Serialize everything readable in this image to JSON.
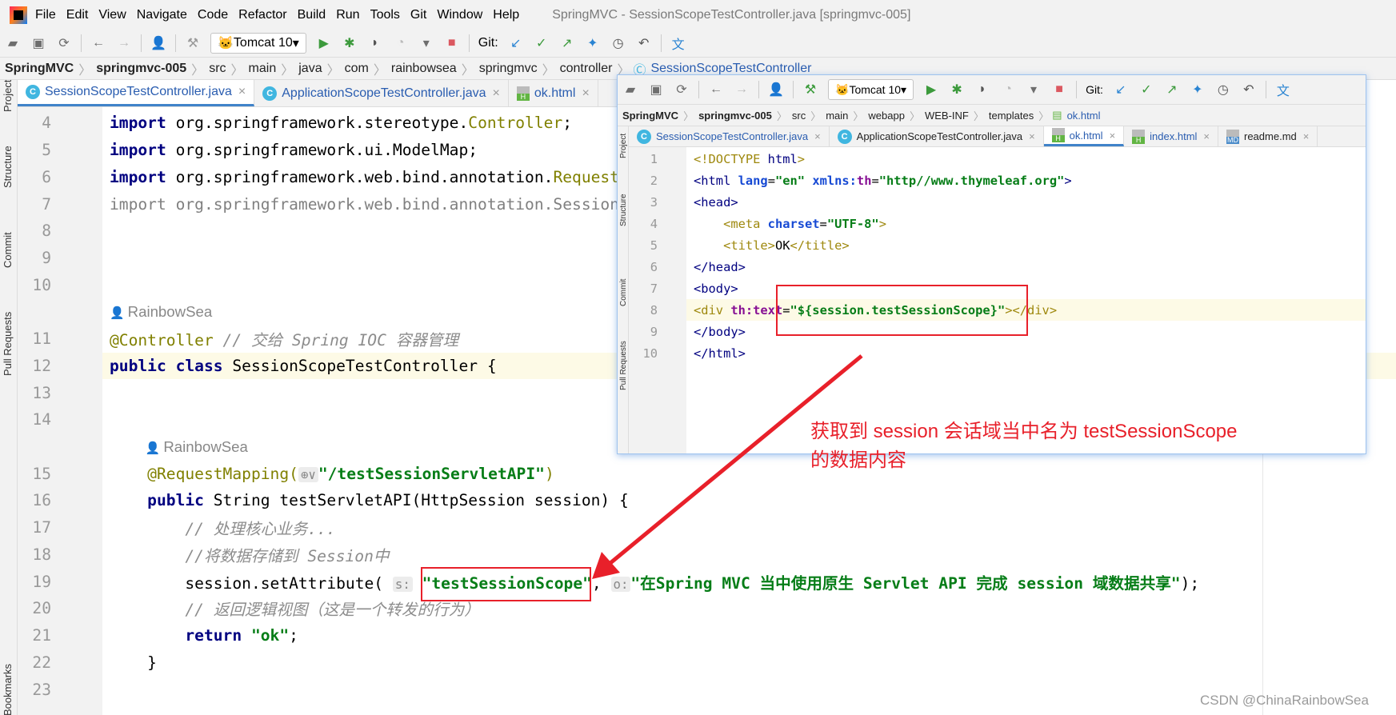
{
  "menubar": {
    "items": [
      "File",
      "Edit",
      "View",
      "Navigate",
      "Code",
      "Refactor",
      "Build",
      "Run",
      "Tools",
      "Git",
      "Window",
      "Help"
    ],
    "title": "SpringMVC - SessionScopeTestController.java [springmvc-005]"
  },
  "toolbar": {
    "run_config": "Tomcat 10",
    "git_label": "Git:"
  },
  "breadcrumb": {
    "items": [
      "SpringMVC",
      "springmvc-005",
      "src",
      "main",
      "java",
      "com",
      "rainbowsea",
      "springmvc",
      "controller",
      "SessionScopeTestController"
    ]
  },
  "tabs": [
    {
      "label": "SessionScopeTestController.java",
      "type": "java",
      "active": true
    },
    {
      "label": "ApplicationScopeTestController.java",
      "type": "java"
    },
    {
      "label": "ok.html",
      "type": "html"
    }
  ],
  "tool_windows": [
    "Project",
    "Structure",
    "Commit",
    "Pull Requests",
    "Bookmarks"
  ],
  "editor": {
    "rows": [
      {
        "ln": "4",
        "seg": [
          [
            "import",
            "kw"
          ],
          [
            " org.springframework.stereotype.",
            "pl"
          ],
          [
            "Controller",
            "ann"
          ],
          [
            ";",
            "pl"
          ]
        ]
      },
      {
        "ln": "5",
        "seg": [
          [
            "import",
            "kw"
          ],
          [
            " org.springframework.ui.ModelMap;",
            "pl"
          ]
        ]
      },
      {
        "ln": "6",
        "seg": [
          [
            "import",
            "kw"
          ],
          [
            " org.springframework.web.bind.annotation.",
            "pl"
          ],
          [
            "RequestMapping",
            "ann"
          ],
          [
            ";",
            "pl"
          ]
        ]
      },
      {
        "ln": "7",
        "seg": [
          [
            "import org.springframework.web.bind.annotation.SessionAttributes;",
            "gray"
          ]
        ]
      },
      {
        "ln": "8",
        "seg": []
      },
      {
        "ln": "9",
        "seg": []
      },
      {
        "ln": "10",
        "seg": []
      },
      {
        "ln": "",
        "inlay": "RainbowSea",
        "indent": 0
      },
      {
        "ln": "11",
        "seg": [
          [
            "@Controller",
            "ann"
          ],
          [
            " // 交给 Spring IOC 容器管理",
            "cm"
          ]
        ]
      },
      {
        "ln": "12",
        "current": true,
        "seg": [
          [
            "public class ",
            "kw"
          ],
          [
            "SessionScopeTestController",
            "pl"
          ],
          [
            " {",
            "pl"
          ]
        ]
      },
      {
        "ln": "13",
        "seg": []
      },
      {
        "ln": "14",
        "seg": []
      },
      {
        "ln": "",
        "inlay": "RainbowSea",
        "indent": 4
      },
      {
        "ln": "15",
        "seg": [
          [
            "    @RequestMapping(",
            "ann"
          ],
          [
            "⊕∨",
            "hint"
          ],
          [
            "\"/testSessionServletAPI\"",
            "str"
          ],
          [
            ")",
            "ann"
          ]
        ]
      },
      {
        "ln": "16",
        "seg": [
          [
            "    public ",
            "kw"
          ],
          [
            "String testServletAPI(HttpSession session) {",
            "pl"
          ]
        ]
      },
      {
        "ln": "17",
        "seg": [
          [
            "        // 处理核心业务...",
            "cm"
          ]
        ]
      },
      {
        "ln": "18",
        "seg": [
          [
            "        //将数据存储到 Session中",
            "cm"
          ]
        ]
      },
      {
        "ln": "19",
        "seg": [
          [
            "        session.setAttribute( ",
            "pl"
          ],
          [
            "s:",
            "hint"
          ],
          [
            " \"testSessionScope\"",
            "str"
          ],
          [
            ", ",
            "pl"
          ],
          [
            "o:",
            "hint"
          ],
          [
            "\"在Spring MVC 当中使用原生 Servlet API 完成 session 域数据共享\"",
            "str"
          ],
          [
            ");",
            "pl"
          ]
        ]
      },
      {
        "ln": "20",
        "seg": [
          [
            "        // 返回逻辑视图（这是一个转发的行为）",
            "cm"
          ]
        ]
      },
      {
        "ln": "21",
        "seg": [
          [
            "        return ",
            "kw"
          ],
          [
            "\"ok\"",
            "str"
          ],
          [
            ";",
            "pl"
          ]
        ]
      },
      {
        "ln": "22",
        "seg": [
          [
            "    }",
            "pl"
          ]
        ]
      },
      {
        "ln": "23",
        "seg": []
      }
    ]
  },
  "popup": {
    "toolbar": {
      "run_config": "Tomcat 10",
      "git_label": "Git:"
    },
    "breadcrumb": {
      "items": [
        "SpringMVC",
        "springmvc-005",
        "src",
        "main",
        "webapp",
        "WEB-INF",
        "templates",
        "ok.html"
      ]
    },
    "tabs": [
      {
        "label": "SessionScopeTestController.java",
        "type": "java"
      },
      {
        "label": "ApplicationScopeTestController.java",
        "type": "java"
      },
      {
        "label": "ok.html",
        "type": "html",
        "active": true
      },
      {
        "label": "index.html",
        "type": "html"
      },
      {
        "label": "readme.md",
        "type": "md"
      }
    ],
    "tool_windows": [
      "Project",
      "Structure",
      "Commit",
      "Pull Requests"
    ],
    "rows": [
      {
        "ln": "1",
        "seg": [
          [
            "<!DOCTYPE ",
            "tago"
          ],
          [
            "html",
            "tag"
          ],
          [
            ">",
            "tago"
          ]
        ]
      },
      {
        "ln": "2",
        "seg": [
          [
            "<html ",
            "tag"
          ],
          [
            "lang",
            "attr"
          ],
          [
            "=",
            "pl"
          ],
          [
            "\"en\"",
            "str"
          ],
          [
            " xmlns:",
            "attr"
          ],
          [
            "th",
            "ns"
          ],
          [
            "=",
            "pl"
          ],
          [
            "\"http//www.thymeleaf.org\"",
            "str"
          ],
          [
            ">",
            "tag"
          ]
        ]
      },
      {
        "ln": "3",
        "seg": [
          [
            "<head>",
            "tag"
          ]
        ]
      },
      {
        "ln": "4",
        "seg": [
          [
            "    <meta ",
            "tago"
          ],
          [
            "charset",
            "attr"
          ],
          [
            "=",
            "pl"
          ],
          [
            "\"UTF-8\"",
            "str"
          ],
          [
            ">",
            "tago"
          ]
        ]
      },
      {
        "ln": "5",
        "seg": [
          [
            "    <title>",
            "tago"
          ],
          [
            "OK",
            "pl"
          ],
          [
            "</title>",
            "tago"
          ]
        ]
      },
      {
        "ln": "6",
        "seg": [
          [
            "</head>",
            "tag"
          ]
        ]
      },
      {
        "ln": "7",
        "seg": [
          [
            "<body>",
            "tag"
          ]
        ]
      },
      {
        "ln": "8",
        "current": true,
        "seg": [
          [
            "<div ",
            "tago"
          ],
          [
            "th:text",
            "ns"
          ],
          [
            "=",
            "pl"
          ],
          [
            "\"${session.testSessionScope}\"",
            "str"
          ],
          [
            "></div>",
            "tago"
          ]
        ]
      },
      {
        "ln": "9",
        "seg": [
          [
            "</body>",
            "tag"
          ]
        ]
      },
      {
        "ln": "10",
        "seg": [
          [
            "</html>",
            "tag"
          ]
        ]
      }
    ]
  },
  "annotation": {
    "line1": "获取到 session 会话域当中名为 testSessionScope",
    "line2": "的数据内容",
    "color": "#e8202a"
  },
  "watermark": "CSDN @ChinaRainbowSea"
}
